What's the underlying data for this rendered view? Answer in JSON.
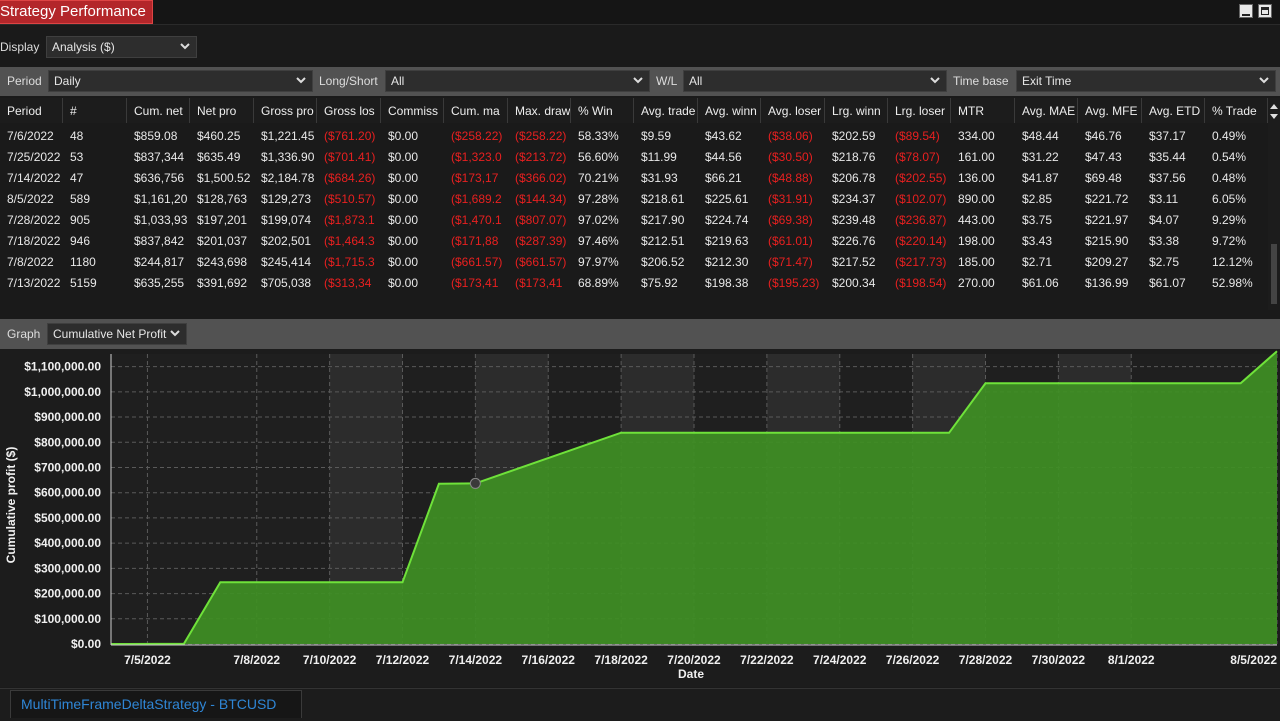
{
  "window": {
    "title": "Strategy Performance",
    "controls": [
      "minimize-icon",
      "maximize-icon"
    ]
  },
  "display": {
    "label": "Display",
    "value": "Analysis ($)"
  },
  "filters": {
    "period_label": "Period",
    "period_value": "Daily",
    "longshort_label": "Long/Short",
    "longshort_value": "All",
    "wl_label": "W/L",
    "wl_value": "All",
    "timebase_label": "Time base",
    "timebase_value": "Exit Time"
  },
  "table": {
    "columns": [
      "Period",
      "#",
      "Cum. net",
      "Net pro",
      "Gross pro",
      "Gross los",
      "Commiss",
      "Cum. ma",
      "Max. draw",
      "% Win",
      "Avg. trade",
      "Avg. winn",
      "Avg. loser",
      "Lrg. winn",
      "Lrg. loser",
      "MTR",
      "Avg. MAE",
      "Avg. MFE",
      "Avg. ETD",
      "% Trade"
    ],
    "rows": [
      [
        "7/6/2022",
        "48",
        "$859.08",
        "$460.25",
        "$1,221.45",
        "($761.20)",
        "$0.00",
        "($258.22)",
        "($258.22)",
        "58.33%",
        "$9.59",
        "$43.62",
        "($38.06)",
        "$202.59",
        "($89.54)",
        "334.00",
        "$48.44",
        "$46.76",
        "$37.17",
        "0.49%"
      ],
      [
        "7/25/2022",
        "53",
        "$837,344",
        "$635.49",
        "$1,336.90",
        "($701.41)",
        "$0.00",
        "($1,323.0",
        "($213.72)",
        "56.60%",
        "$11.99",
        "$44.56",
        "($30.50)",
        "$218.76",
        "($78.07)",
        "161.00",
        "$31.22",
        "$47.43",
        "$35.44",
        "0.54%"
      ],
      [
        "7/14/2022",
        "47",
        "$636,756",
        "$1,500.52",
        "$2,184.78",
        "($684.26)",
        "$0.00",
        "($173,17",
        "($366.02)",
        "70.21%",
        "$31.93",
        "$66.21",
        "($48.88)",
        "$206.78",
        "($202.55)",
        "136.00",
        "$41.87",
        "$69.48",
        "$37.56",
        "0.48%"
      ],
      [
        "8/5/2022",
        "589",
        "$1,161,20",
        "$128,763",
        "$129,273",
        "($510.57)",
        "$0.00",
        "($1,689.2",
        "($144.34)",
        "97.28%",
        "$218.61",
        "$225.61",
        "($31.91)",
        "$234.37",
        "($102.07)",
        "890.00",
        "$2.85",
        "$221.72",
        "$3.11",
        "6.05%"
      ],
      [
        "7/28/2022",
        "905",
        "$1,033,93",
        "$197,201",
        "$199,074",
        "($1,873.1",
        "$0.00",
        "($1,470.1",
        "($807.07)",
        "97.02%",
        "$217.90",
        "$224.74",
        "($69.38)",
        "$239.48",
        "($236.87)",
        "443.00",
        "$3.75",
        "$221.97",
        "$4.07",
        "9.29%"
      ],
      [
        "7/18/2022",
        "946",
        "$837,842",
        "$201,037",
        "$202,501",
        "($1,464.3",
        "$0.00",
        "($171,88",
        "($287.39)",
        "97.46%",
        "$212.51",
        "$219.63",
        "($61.01)",
        "$226.76",
        "($220.14)",
        "198.00",
        "$3.43",
        "$215.90",
        "$3.38",
        "9.72%"
      ],
      [
        "7/8/2022",
        "1180",
        "$244,817",
        "$243,698",
        "$245,414",
        "($1,715.3",
        "$0.00",
        "($661.57)",
        "($661.57)",
        "97.97%",
        "$206.52",
        "$212.30",
        "($71.47)",
        "$217.52",
        "($217.73)",
        "185.00",
        "$2.71",
        "$209.27",
        "$2.75",
        "12.12%"
      ],
      [
        "7/13/2022",
        "5159",
        "$635,255",
        "$391,692",
        "$705,038",
        "($313,34",
        "$0.00",
        "($173,41",
        "($173,41",
        "68.89%",
        "$75.92",
        "$198.38",
        "($195.23)",
        "$200.34",
        "($198.54)",
        "270.00",
        "$61.06",
        "$136.99",
        "$61.07",
        "52.98%"
      ]
    ]
  },
  "graph": {
    "label": "Graph",
    "value": "Cumulative Net Profit"
  },
  "chart_data": {
    "type": "area",
    "title": "",
    "xlabel": "Date",
    "ylabel": "Cumulative profit ($)",
    "xlim": [
      "7/4/2022",
      "8/5/2022"
    ],
    "ylim": [
      0,
      1150000
    ],
    "grid": true,
    "x_ticks": [
      "7/5/2022",
      "7/8/2022",
      "7/10/2022",
      "7/12/2022",
      "7/14/2022",
      "7/16/2022",
      "7/18/2022",
      "7/20/2022",
      "7/22/2022",
      "7/24/2022",
      "7/26/2022",
      "7/28/2022",
      "7/30/2022",
      "8/1/2022",
      "8/5/2022"
    ],
    "y_ticks": [
      "$0.00",
      "$100,000.00",
      "$200,000.00",
      "$300,000.00",
      "$400,000.00",
      "$500,000.00",
      "$600,000.00",
      "$700,000.00",
      "$800,000.00",
      "$900,000.00",
      "$1,000,000.00",
      "$1,100,000.00"
    ],
    "series": [
      {
        "x": [
          "7/4/2022",
          "7/6/2022",
          "7/7/2022",
          "7/8/2022",
          "7/12/2022",
          "7/13/2022",
          "7/14/2022",
          "7/18/2022",
          "7/25/2022",
          "7/27/2022",
          "7/28/2022",
          "8/3/2022",
          "8/4/2022",
          "8/5/2022"
        ],
        "values": [
          0,
          859,
          245000,
          244817,
          244817,
          635255,
          636756,
          837842,
          837344,
          837344,
          1033930,
          1033930,
          1033930,
          1161200
        ]
      }
    ],
    "highlight_point": {
      "x": "7/14/2022",
      "y": 636756
    },
    "colors": {
      "area": "#3f8f24",
      "line": "#6fe23a",
      "band": "#2c2c2c",
      "background": "#1f1f1f"
    }
  },
  "footer": {
    "strategy_tab": "MultiTimeFrameDeltaStrategy - BTCUSD"
  }
}
